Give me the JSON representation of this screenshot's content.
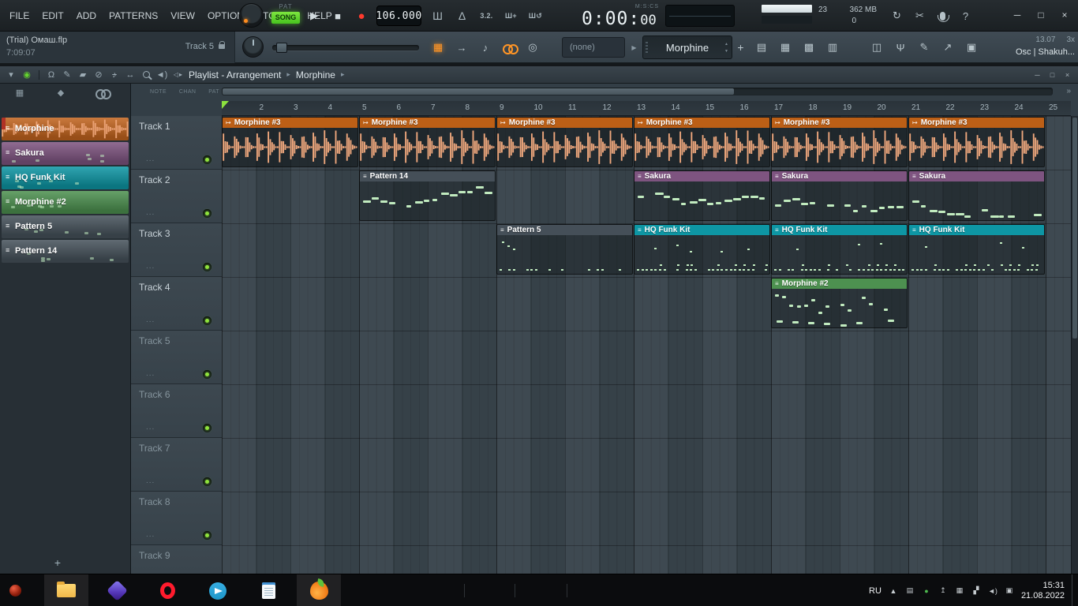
{
  "menubar": [
    "FILE",
    "EDIT",
    "ADD",
    "PATTERNS",
    "VIEW",
    "OPTIONS",
    "TOOLS",
    "HELP"
  ],
  "transport": {
    "pat": "PAT",
    "song": "SONG",
    "tempo": "106.000",
    "time_main": "0:00:",
    "time_cs": "00",
    "time_format": "M:S:CS"
  },
  "perf": {
    "cpu": "23",
    "mem": "362 MB",
    "poly": "0"
  },
  "project": {
    "name": "(Trial) Омаш.flp",
    "elapsed": "7:09:07",
    "hint": "Track 5"
  },
  "selectors": {
    "none": "(none)",
    "pattern": "Morphine"
  },
  "right_info": {
    "a": "13.07",
    "b": "3x",
    "c": "Osc | Shakuh..."
  },
  "icons": {
    "play": "▶",
    "stop": "■",
    "record": "●",
    "pattern_clip": "≡",
    "audio_clip": "↦",
    "crumb_arrow": "▸",
    "nav_arrows": "◁▸",
    "scroll_end": "»",
    "plus": "+",
    "dd_arrow": "▶",
    "spin_up": "▲",
    "spin_down": "▼"
  },
  "icons_strips": {
    "transport_opts": [
      {
        "name": "typing-keyboard-icon",
        "glyph": "Ш"
      },
      {
        "name": "metronome-icon",
        "glyph": "Δ"
      },
      {
        "name": "countdown-icon",
        "glyph": "3.2.",
        "small": true
      },
      {
        "name": "wait-input-icon",
        "glyph": "Ш+",
        "small": true
      },
      {
        "name": "loop-record-icon",
        "glyph": "Ш↺",
        "small": true
      }
    ],
    "utility": [
      {
        "name": "autosave-icon",
        "glyph": "↻"
      },
      {
        "name": "cut-icon",
        "glyph": "✂"
      },
      {
        "name": "mic-icon",
        "css": "mic"
      },
      {
        "name": "help-icon",
        "glyph": "?"
      }
    ],
    "window": [
      {
        "name": "minimize-button",
        "glyph": "─"
      },
      {
        "name": "maximize-button",
        "glyph": "□"
      },
      {
        "name": "close-button",
        "glyph": "×"
      }
    ],
    "row2_left": [
      {
        "name": "step-sequencer-toggle",
        "glyph": "▦",
        "lit": true
      },
      {
        "name": "arrow-icon",
        "glyph": "→"
      },
      {
        "name": "note-icon",
        "glyph": "♪"
      },
      {
        "name": "chain-link-icon",
        "css": "chain",
        "lit": true
      },
      {
        "name": "kick-icon",
        "glyph": "◎"
      }
    ],
    "row2_panels": [
      {
        "name": "playlist-button",
        "glyph": "▤"
      },
      {
        "name": "piano-roll-button",
        "glyph": "▦"
      },
      {
        "name": "channel-rack-button",
        "glyph": "▩"
      },
      {
        "name": "mixer-button",
        "glyph": "▥"
      }
    ],
    "row2_tools": [
      {
        "name": "plugin-picker-button",
        "glyph": "◫"
      },
      {
        "name": "tuner-button",
        "glyph": "Ψ"
      },
      {
        "name": "edit-button",
        "glyph": "✎"
      },
      {
        "name": "export-button",
        "glyph": "↗"
      },
      {
        "name": "shop-button",
        "glyph": "▣"
      }
    ],
    "playlist_tools": [
      {
        "name": "playlist-menu-icon",
        "glyph": "▾"
      },
      {
        "name": "auto-scroll-icon",
        "glyph": "◉",
        "color": "#63d22e"
      },
      {
        "sep": true
      },
      {
        "name": "magnet-icon",
        "glyph": "Ω"
      },
      {
        "name": "pencil-tool",
        "glyph": "✎"
      },
      {
        "name": "paint-tool",
        "glyph": "▰"
      },
      {
        "name": "delete-tool",
        "glyph": "⊘"
      },
      {
        "name": "mute-tool",
        "glyph": "♪",
        "strike": true
      },
      {
        "name": "slip-tool",
        "glyph": "↔"
      },
      {
        "name": "zoom-tool",
        "css": "zoom"
      },
      {
        "name": "playback-tool",
        "glyph": "◄)"
      }
    ],
    "sidebar_views": [
      {
        "name": "view-grid-icon",
        "glyph": "▦"
      },
      {
        "name": "view-patterns-icon",
        "glyph": "◆"
      },
      {
        "name": "view-chain-icon",
        "css": "chain"
      }
    ],
    "playlist_window": [
      {
        "name": "playlist-minimize-button",
        "glyph": "─"
      },
      {
        "name": "playlist-maximize-button",
        "glyph": "□"
      },
      {
        "name": "playlist-close-button",
        "glyph": "×"
      }
    ]
  },
  "playlist": {
    "title": "Playlist - Arrangement",
    "sub": "Morphine",
    "cols": [
      "NOTE",
      "CHAN",
      "PAT"
    ],
    "track_more": "...",
    "bars": {
      "first": 2,
      "last": 25
    },
    "patterns": [
      {
        "name": "Morphine",
        "kind": "audio",
        "color": "#c2641e",
        "selected": true
      },
      {
        "name": "Sakura",
        "kind": "melody",
        "color": "#7e5480"
      },
      {
        "name": "HQ Funk Kit",
        "kind": "drums",
        "color": "#0e96a4"
      },
      {
        "name": "Morphine #2",
        "kind": "melody",
        "color": "#4d9150"
      },
      {
        "name": "Pattern 5",
        "kind": "drums",
        "color": "#46525b"
      },
      {
        "name": "Pattern 14",
        "kind": "melody",
        "color": "#46525b"
      }
    ],
    "tracks": [
      {
        "name": "Track 1",
        "active": true
      },
      {
        "name": "Track 2",
        "active": true
      },
      {
        "name": "Track 3",
        "active": true
      },
      {
        "name": "Track 4",
        "active": true
      },
      {
        "name": "Track 5",
        "active": false
      },
      {
        "name": "Track 6",
        "active": false
      },
      {
        "name": "Track 7",
        "active": false
      },
      {
        "name": "Track 8",
        "active": false
      },
      {
        "name": "Track 9",
        "active": false
      }
    ],
    "clips": [
      {
        "track": 1,
        "bar": 1,
        "len": 4,
        "label": "Morphine #3",
        "kind": "audio",
        "color": "#bc5f16"
      },
      {
        "track": 1,
        "bar": 5,
        "len": 4,
        "label": "Morphine #3",
        "kind": "audio",
        "color": "#bc5f16"
      },
      {
        "track": 1,
        "bar": 9,
        "len": 4,
        "label": "Morphine #3",
        "kind": "audio",
        "color": "#bc5f16"
      },
      {
        "track": 1,
        "bar": 13,
        "len": 4,
        "label": "Morphine #3",
        "kind": "audio",
        "color": "#bc5f16"
      },
      {
        "track": 1,
        "bar": 17,
        "len": 4,
        "label": "Morphine #3",
        "kind": "audio",
        "color": "#bc5f16"
      },
      {
        "track": 1,
        "bar": 21,
        "len": 4,
        "label": "Morphine #3",
        "kind": "audio",
        "color": "#bc5f16"
      },
      {
        "track": 2,
        "bar": 5,
        "len": 4,
        "label": "Pattern 14",
        "kind": "melody",
        "color": "#454f58",
        "seed": 140
      },
      {
        "track": 2,
        "bar": 13,
        "len": 4,
        "label": "Sakura",
        "kind": "melody",
        "color": "#7e5480",
        "seed": 211
      },
      {
        "track": 2,
        "bar": 17,
        "len": 4,
        "label": "Sakura",
        "kind": "melody",
        "color": "#7e5480",
        "seed": 212
      },
      {
        "track": 2,
        "bar": 21,
        "len": 4,
        "label": "Sakura",
        "kind": "melody",
        "color": "#7e5480",
        "seed": 213
      },
      {
        "track": 3,
        "bar": 9,
        "len": 4,
        "label": "Pattern 5",
        "kind": "drums_sparse",
        "color": "#454f58",
        "seed": 55
      },
      {
        "track": 3,
        "bar": 13,
        "len": 4,
        "label": "HQ Funk Kit",
        "kind": "drums",
        "color": "#0e96a4",
        "seed": 311
      },
      {
        "track": 3,
        "bar": 17,
        "len": 4,
        "label": "HQ Funk Kit",
        "kind": "drums",
        "color": "#0e96a4",
        "seed": 312
      },
      {
        "track": 3,
        "bar": 21,
        "len": 4,
        "label": "HQ Funk Kit",
        "kind": "drums",
        "color": "#0e96a4",
        "seed": 313
      },
      {
        "track": 4,
        "bar": 17,
        "len": 4,
        "label": "Morphine #2",
        "kind": "melody2",
        "color": "#4d9150",
        "seed": 42
      }
    ]
  },
  "taskbar": {
    "lang": "RU",
    "time": "15:31",
    "date": "21.08.2022",
    "apps": [
      {
        "name": "taskbar-explorer",
        "css": "folder",
        "active": true
      },
      {
        "name": "taskbar-media-app",
        "css": "purple",
        "active": false
      },
      {
        "name": "taskbar-opera",
        "css": "opera",
        "active": false
      },
      {
        "name": "taskbar-telegram",
        "css": "telegram",
        "active": false
      },
      {
        "name": "taskbar-notepad",
        "css": "notepad",
        "active": false
      },
      {
        "name": "taskbar-flstudio",
        "css": "fl",
        "active": true
      }
    ],
    "tray": [
      {
        "name": "tray-hidden-icons-chevron",
        "glyph": "▲"
      },
      {
        "name": "tray-display-icon",
        "glyph": "▤"
      },
      {
        "name": "tray-status-icon",
        "glyph": "●",
        "color": "#4db84e"
      },
      {
        "name": "tray-upload-icon",
        "glyph": "↥"
      },
      {
        "name": "tray-sync-icon",
        "glyph": "▦"
      },
      {
        "name": "tray-network-icon",
        "glyph": "▞"
      },
      {
        "name": "tray-volume-icon",
        "glyph": "◄)"
      },
      {
        "name": "tray-touch-keyboard-icon",
        "glyph": "▣"
      }
    ]
  }
}
